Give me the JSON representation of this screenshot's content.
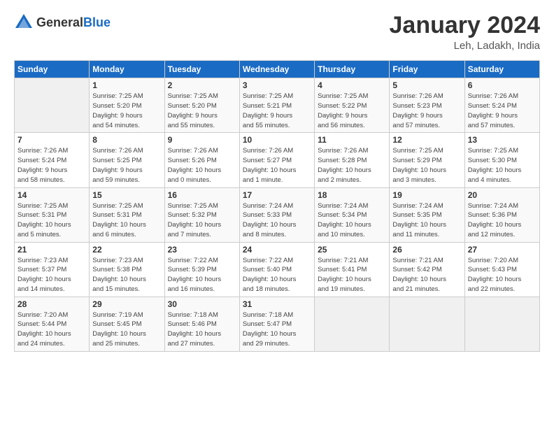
{
  "logo": {
    "text_general": "General",
    "text_blue": "Blue"
  },
  "header": {
    "month_year": "January 2024",
    "location": "Leh, Ladakh, India"
  },
  "days_of_week": [
    "Sunday",
    "Monday",
    "Tuesday",
    "Wednesday",
    "Thursday",
    "Friday",
    "Saturday"
  ],
  "weeks": [
    [
      {
        "day": "",
        "info": ""
      },
      {
        "day": "1",
        "info": "Sunrise: 7:25 AM\nSunset: 5:20 PM\nDaylight: 9 hours\nand 54 minutes."
      },
      {
        "day": "2",
        "info": "Sunrise: 7:25 AM\nSunset: 5:20 PM\nDaylight: 9 hours\nand 55 minutes."
      },
      {
        "day": "3",
        "info": "Sunrise: 7:25 AM\nSunset: 5:21 PM\nDaylight: 9 hours\nand 55 minutes."
      },
      {
        "day": "4",
        "info": "Sunrise: 7:25 AM\nSunset: 5:22 PM\nDaylight: 9 hours\nand 56 minutes."
      },
      {
        "day": "5",
        "info": "Sunrise: 7:26 AM\nSunset: 5:23 PM\nDaylight: 9 hours\nand 57 minutes."
      },
      {
        "day": "6",
        "info": "Sunrise: 7:26 AM\nSunset: 5:24 PM\nDaylight: 9 hours\nand 57 minutes."
      }
    ],
    [
      {
        "day": "7",
        "info": "Sunrise: 7:26 AM\nSunset: 5:24 PM\nDaylight: 9 hours\nand 58 minutes."
      },
      {
        "day": "8",
        "info": "Sunrise: 7:26 AM\nSunset: 5:25 PM\nDaylight: 9 hours\nand 59 minutes."
      },
      {
        "day": "9",
        "info": "Sunrise: 7:26 AM\nSunset: 5:26 PM\nDaylight: 10 hours\nand 0 minutes."
      },
      {
        "day": "10",
        "info": "Sunrise: 7:26 AM\nSunset: 5:27 PM\nDaylight: 10 hours\nand 1 minute."
      },
      {
        "day": "11",
        "info": "Sunrise: 7:26 AM\nSunset: 5:28 PM\nDaylight: 10 hours\nand 2 minutes."
      },
      {
        "day": "12",
        "info": "Sunrise: 7:25 AM\nSunset: 5:29 PM\nDaylight: 10 hours\nand 3 minutes."
      },
      {
        "day": "13",
        "info": "Sunrise: 7:25 AM\nSunset: 5:30 PM\nDaylight: 10 hours\nand 4 minutes."
      }
    ],
    [
      {
        "day": "14",
        "info": "Sunrise: 7:25 AM\nSunset: 5:31 PM\nDaylight: 10 hours\nand 5 minutes."
      },
      {
        "day": "15",
        "info": "Sunrise: 7:25 AM\nSunset: 5:31 PM\nDaylight: 10 hours\nand 6 minutes."
      },
      {
        "day": "16",
        "info": "Sunrise: 7:25 AM\nSunset: 5:32 PM\nDaylight: 10 hours\nand 7 minutes."
      },
      {
        "day": "17",
        "info": "Sunrise: 7:24 AM\nSunset: 5:33 PM\nDaylight: 10 hours\nand 8 minutes."
      },
      {
        "day": "18",
        "info": "Sunrise: 7:24 AM\nSunset: 5:34 PM\nDaylight: 10 hours\nand 10 minutes."
      },
      {
        "day": "19",
        "info": "Sunrise: 7:24 AM\nSunset: 5:35 PM\nDaylight: 10 hours\nand 11 minutes."
      },
      {
        "day": "20",
        "info": "Sunrise: 7:24 AM\nSunset: 5:36 PM\nDaylight: 10 hours\nand 12 minutes."
      }
    ],
    [
      {
        "day": "21",
        "info": "Sunrise: 7:23 AM\nSunset: 5:37 PM\nDaylight: 10 hours\nand 14 minutes."
      },
      {
        "day": "22",
        "info": "Sunrise: 7:23 AM\nSunset: 5:38 PM\nDaylight: 10 hours\nand 15 minutes."
      },
      {
        "day": "23",
        "info": "Sunrise: 7:22 AM\nSunset: 5:39 PM\nDaylight: 10 hours\nand 16 minutes."
      },
      {
        "day": "24",
        "info": "Sunrise: 7:22 AM\nSunset: 5:40 PM\nDaylight: 10 hours\nand 18 minutes."
      },
      {
        "day": "25",
        "info": "Sunrise: 7:21 AM\nSunset: 5:41 PM\nDaylight: 10 hours\nand 19 minutes."
      },
      {
        "day": "26",
        "info": "Sunrise: 7:21 AM\nSunset: 5:42 PM\nDaylight: 10 hours\nand 21 minutes."
      },
      {
        "day": "27",
        "info": "Sunrise: 7:20 AM\nSunset: 5:43 PM\nDaylight: 10 hours\nand 22 minutes."
      }
    ],
    [
      {
        "day": "28",
        "info": "Sunrise: 7:20 AM\nSunset: 5:44 PM\nDaylight: 10 hours\nand 24 minutes."
      },
      {
        "day": "29",
        "info": "Sunrise: 7:19 AM\nSunset: 5:45 PM\nDaylight: 10 hours\nand 25 minutes."
      },
      {
        "day": "30",
        "info": "Sunrise: 7:18 AM\nSunset: 5:46 PM\nDaylight: 10 hours\nand 27 minutes."
      },
      {
        "day": "31",
        "info": "Sunrise: 7:18 AM\nSunset: 5:47 PM\nDaylight: 10 hours\nand 29 minutes."
      },
      {
        "day": "",
        "info": ""
      },
      {
        "day": "",
        "info": ""
      },
      {
        "day": "",
        "info": ""
      }
    ]
  ]
}
